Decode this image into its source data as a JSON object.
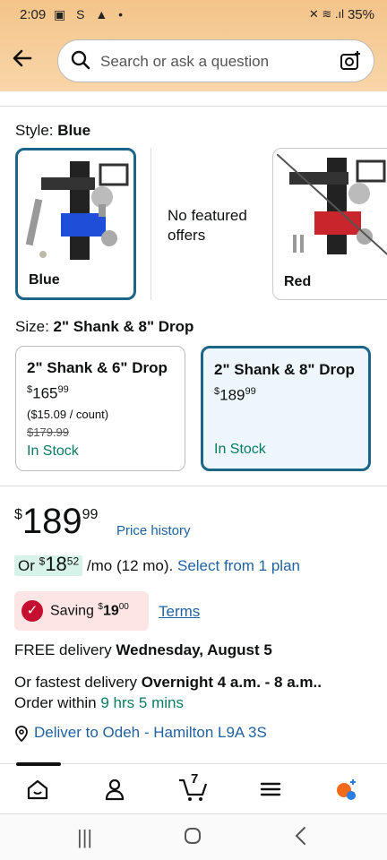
{
  "status": {
    "time": "2:09",
    "left_icons": "▣ S ▲ •",
    "right_icons": "✕ ≋ .ıl",
    "battery": "35%"
  },
  "search": {
    "placeholder": "Search or ask a question"
  },
  "style": {
    "label": "Style:",
    "value": "Blue",
    "options": [
      {
        "name": "Blue",
        "state": "selected"
      },
      {
        "name": "Red",
        "state": "unavailable"
      }
    ],
    "no_offers": "No featured offers"
  },
  "size": {
    "label": "Size:",
    "value": "2\" Shank & 8\" Drop",
    "options": [
      {
        "title": "2\" Shank & 6\" Drop",
        "price_currency": "$",
        "price_whole": "165",
        "price_frac": "99",
        "unit": "($15.09 / count)",
        "strike": "$179.99",
        "stock": "In Stock"
      },
      {
        "title": "2\" Shank & 8\" Drop",
        "price_currency": "$",
        "price_whole": "189",
        "price_frac": "99",
        "stock": "In Stock"
      }
    ]
  },
  "price": {
    "currency": "$",
    "whole": "189",
    "frac": "99",
    "history": "Price history"
  },
  "monthly": {
    "prefix": "Or",
    "currency": "$",
    "whole": "18",
    "frac": "52",
    "suffix": "/mo (12 mo).",
    "link": "Select from 1 plan"
  },
  "saving": {
    "label": "Saving",
    "currency": "$",
    "whole": "19",
    "frac": "00",
    "terms": "Terms"
  },
  "delivery": {
    "free_prefix": "FREE delivery",
    "free_date": "Wednesday, August 5",
    "fast_prefix": "Or fastest delivery",
    "fast_date": "Overnight 4 a.m. - 8 a.m..",
    "order_prefix": "Order within",
    "order_time": "9 hrs 5 mins",
    "deliver_to": "Deliver to Odeh - Hamilton L9A 3S"
  },
  "nav": {
    "cart_count": "7"
  },
  "colors": {
    "accent": "#1b6688",
    "link": "#2162a1",
    "instock": "#067d62",
    "saving_red": "#c40f30"
  }
}
